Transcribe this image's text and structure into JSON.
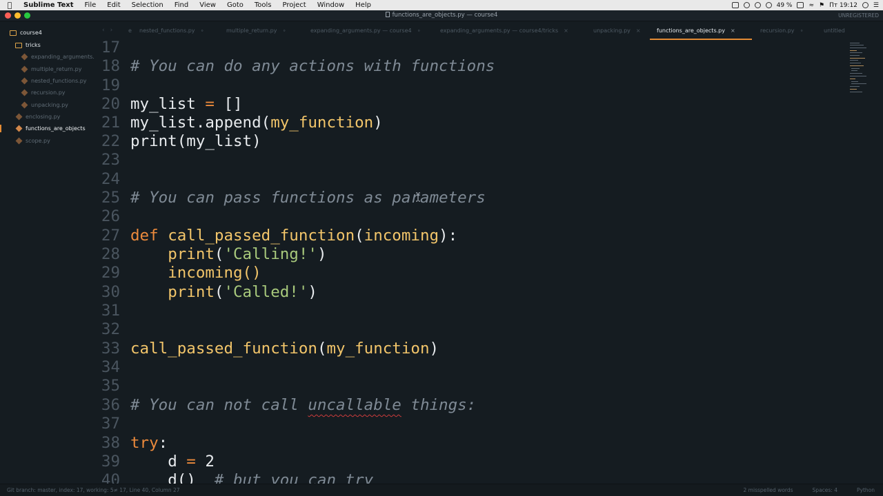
{
  "menubar": {
    "app_name": "Sublime Text",
    "items": [
      "File",
      "Edit",
      "Selection",
      "Find",
      "View",
      "Goto",
      "Tools",
      "Project",
      "Window",
      "Help"
    ],
    "battery": "49 %",
    "clock": "Пт 19:12"
  },
  "window": {
    "title": "functions_are_objects.py — course4",
    "registration": "UNREGISTERED"
  },
  "sidebar": {
    "root_folder": "course4",
    "subfolder": "tricks",
    "subfolder_files": [
      "expanding_arguments.",
      "multiple_return.py",
      "nested_functions.py",
      "recursion.py",
      "unpacking.py"
    ],
    "root_files": [
      "enclosing.py",
      "functions_are_objects",
      "scope.py"
    ],
    "active_file": "functions_are_objects"
  },
  "tabs": [
    {
      "label": "e"
    },
    {
      "label": "nested_functions.py"
    },
    {
      "label": "multiple_return.py"
    },
    {
      "label": "expanding_arguments.py — course4"
    },
    {
      "label": "expanding_arguments.py — course4/tricks"
    },
    {
      "label": "unpacking.py"
    },
    {
      "label": "functions_are_objects.py",
      "active": true
    },
    {
      "label": "recursion.py"
    },
    {
      "label": "untitled"
    }
  ],
  "code": {
    "line_numbers": [
      "17",
      "18",
      "19",
      "20",
      "21",
      "22",
      "23",
      "24",
      "25",
      "26",
      "27",
      "28",
      "29",
      "30",
      "31",
      "32",
      "33",
      "34",
      "35",
      "36",
      "37",
      "38",
      "39",
      "40"
    ],
    "l18": "# You can do any actions with functions",
    "l20_name": "my_list",
    "l20_op": "=",
    "l20_val": "[]",
    "l21_obj": "my_list.append(",
    "l21_arg": "my_function",
    "l21_close": ")",
    "l22_fn": "print",
    "l22_rest": "(my_list)",
    "l25": "# You can pass functions as parameters",
    "l27_kw": "def",
    "l27_fn": "call_passed_function",
    "l27_open": "(",
    "l27_param": "incoming",
    "l27_close": "):",
    "l28_fn": "print",
    "l28_open": "(",
    "l28_str": "'Calling!'",
    "l28_close": ")",
    "l29": "incoming()",
    "l30_fn": "print",
    "l30_open": "(",
    "l30_str": "'Called!'",
    "l30_close": ")",
    "l33_fn": "call_passed_function",
    "l33_open": "(",
    "l33_arg": "my_function",
    "l33_close": ")",
    "l36_pre": "# You can not call ",
    "l36_mis": "uncallable",
    "l36_post": " things:",
    "l38_kw": "try",
    "l38_colon": ":",
    "l39_name": "d",
    "l39_op": "=",
    "l39_num": "2",
    "l40_code": "d()",
    "l40_comment": "# but you can try"
  },
  "statusbar": {
    "left": "Git branch: master, index: 17, working: 5≠ 17, Line 40, Column 27",
    "misspelled": "2 misspelled words",
    "spaces": "Spaces: 4",
    "syntax": "Python"
  },
  "colors": {
    "accent": "#e48b34",
    "keyword": "#ec8a3c",
    "function": "#f2c56a",
    "string": "#a8c97c",
    "comment": "#7f8a95",
    "background": "#151c21"
  }
}
